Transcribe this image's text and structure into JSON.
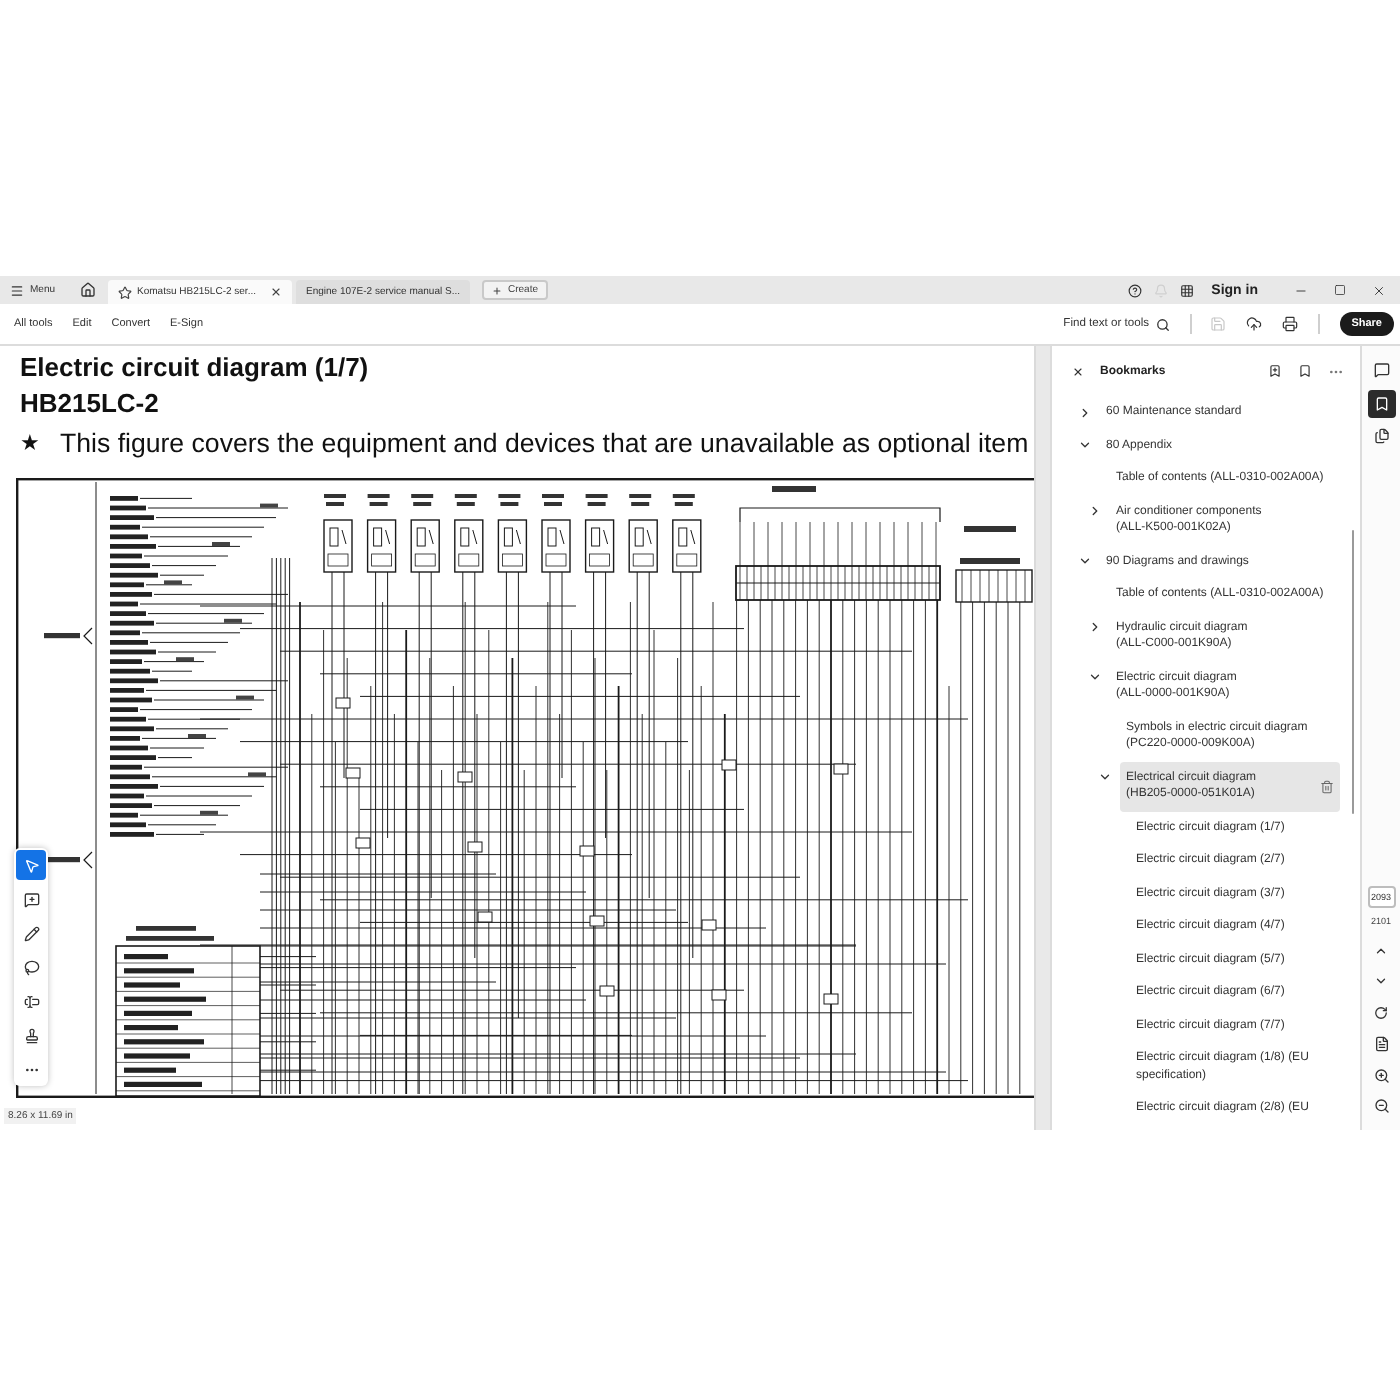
{
  "tab_bar": {
    "menu_label": "Menu",
    "tabs": [
      {
        "label": "Komatsu HB215LC-2 ser...",
        "selected": true,
        "starred": true
      },
      {
        "label": "Engine 107E-2 service manual S...",
        "selected": false,
        "starred": false
      }
    ],
    "create_label": "Create",
    "actions": [
      {
        "kind": "help",
        "disabled": false
      },
      {
        "kind": "notifications",
        "disabled": true
      },
      {
        "kind": "apps",
        "disabled": false
      }
    ],
    "sign_in_label": "Sign in"
  },
  "toolbar": {
    "menu_items": [
      "All tools",
      "Edit",
      "Convert",
      "E-Sign"
    ],
    "find_label": "Find text or tools",
    "actions": [
      {
        "kind": "save",
        "disabled": true
      },
      {
        "kind": "upload",
        "disabled": false
      },
      {
        "kind": "print",
        "disabled": false
      }
    ],
    "share_label": "Share"
  },
  "document": {
    "title": "Electric circuit diagram (1/7)",
    "model": "HB215LC-2",
    "note": {
      "marker": "★",
      "text": "This figure covers the equipment and devices that are unavailable as optional item"
    },
    "tools": [
      {
        "kind": "select",
        "selected": true
      },
      {
        "kind": "comment",
        "selected": false
      },
      {
        "kind": "draw",
        "selected": false
      },
      {
        "kind": "shape",
        "selected": false
      },
      {
        "kind": "text",
        "selected": false
      },
      {
        "kind": "stamp",
        "selected": false
      },
      {
        "kind": "more",
        "selected": false
      }
    ],
    "page_size": "8.26 x 11.69 in"
  },
  "bookmarks": {
    "title": "Bookmarks",
    "items": [
      {
        "label": "60 Maintenance standard",
        "kind": "group",
        "expanded": false,
        "selected": false
      },
      {
        "label": "80 Appendix",
        "kind": "group",
        "expanded": true,
        "selected": false,
        "children": [
          {
            "label": "Table of contents (ALL-0310-002A00A)",
            "kind": "entry",
            "selected": false
          },
          {
            "label": "Air conditioner components (ALL-K500-001K02A)",
            "kind": "group",
            "expanded": false,
            "selected": false
          }
        ]
      },
      {
        "label": "90 Diagrams and drawings",
        "kind": "group",
        "expanded": true,
        "selected": false,
        "children": [
          {
            "label": "Table of contents (ALL-0310-002A00A)",
            "kind": "entry",
            "selected": false
          },
          {
            "label": "Hydraulic circuit diagram (ALL-C000-001K90A)",
            "kind": "group",
            "expanded": false,
            "selected": false
          },
          {
            "label": "Electric circuit diagram (ALL-0000-001K90A)",
            "kind": "group",
            "expanded": true,
            "selected": false,
            "children": [
              {
                "label": "Symbols in electric circuit diagram (PC220-0000-009K00A)",
                "kind": "entry",
                "selected": false
              },
              {
                "label": "Electrical circuit diagram (HB205-0000-051K01A)",
                "kind": "group",
                "expanded": true,
                "selected": true,
                "children": [
                  {
                    "label": "Electric circuit diagram (1/7)",
                    "kind": "entry",
                    "selected": false
                  },
                  {
                    "label": "Electric circuit diagram (2/7)",
                    "kind": "entry",
                    "selected": false
                  },
                  {
                    "label": "Electric circuit diagram (3/7)",
                    "kind": "entry",
                    "selected": false
                  },
                  {
                    "label": "Electric circuit diagram (4/7)",
                    "kind": "entry",
                    "selected": false
                  },
                  {
                    "label": "Electric circuit diagram (5/7)",
                    "kind": "entry",
                    "selected": false
                  },
                  {
                    "label": "Electric circuit diagram (6/7)",
                    "kind": "entry",
                    "selected": false
                  },
                  {
                    "label": "Electric circuit diagram (7/7)",
                    "kind": "entry",
                    "selected": false
                  },
                  {
                    "label": "Electric circuit diagram (1/8) (EU specification)",
                    "kind": "entry",
                    "selected": false
                  },
                  {
                    "label": "Electric circuit diagram (2/8) (EU",
                    "kind": "entry",
                    "selected": false
                  }
                ]
              }
            ]
          }
        ]
      }
    ]
  },
  "side_rail": {
    "panels": [
      {
        "kind": "comments",
        "selected": false
      },
      {
        "kind": "bookmarks",
        "selected": true
      },
      {
        "kind": "pages",
        "selected": false
      }
    ],
    "page_number": "2093",
    "page_count": "2101"
  }
}
